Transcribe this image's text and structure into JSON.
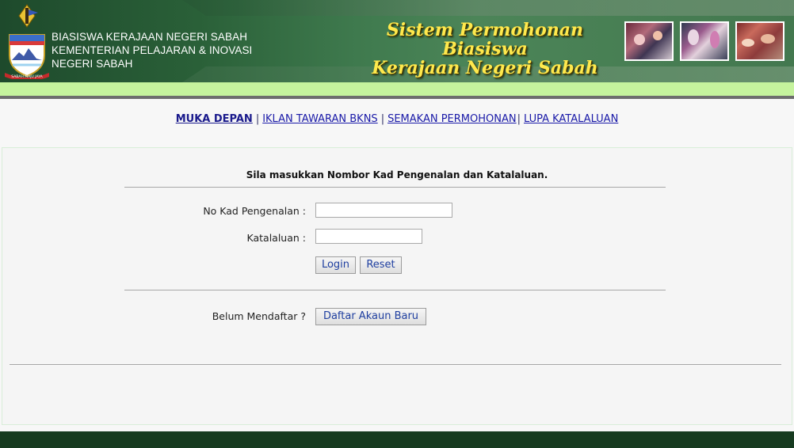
{
  "header": {
    "lines": [
      "BIASISWA KERAJAAN NEGERI SABAH",
      "KEMENTERIAN PELAJARAN & INOVASI",
      "NEGERI SABAH"
    ],
    "system_title_1": "Sistem Permohonan Biasiswa",
    "system_title_2": "Kerajaan Negeri Sabah",
    "crest_motto": "SABAH MAJU JAYA"
  },
  "nav": {
    "items": [
      {
        "label": "MUKA DEPAN",
        "active": true
      },
      {
        "label": "IKLAN TAWARAN BKNS",
        "active": false
      },
      {
        "label": "SEMAKAN PERMOHONAN",
        "active": false
      },
      {
        "label": "LUPA KATALALUAN",
        "active": false
      }
    ]
  },
  "form": {
    "instruction": "Sila masukkan Nombor Kad Pengenalan dan Katalaluan.",
    "ic_label": "No Kad Pengenalan :",
    "ic_value": "",
    "password_label": "Katalaluan :",
    "password_value": "",
    "login_button": "Login",
    "reset_button": "Reset",
    "register_label": "Belum Mendaftar ?",
    "register_button": "Daftar Akaun Baru"
  },
  "colors": {
    "header_green": "#2a6038",
    "lime": "#c5f39d",
    "title_yellow": "#ffe94d",
    "link_blue": "#1a1aa8",
    "footer_green": "#173b20"
  }
}
